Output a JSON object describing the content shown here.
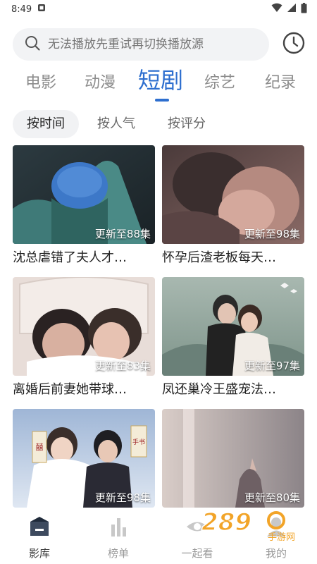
{
  "status_bar": {
    "time": "8:49"
  },
  "search": {
    "placeholder": "无法播放先重试再切换播放源"
  },
  "categories": [
    {
      "label": "电影"
    },
    {
      "label": "动漫"
    },
    {
      "label": "短剧"
    },
    {
      "label": "综艺"
    },
    {
      "label": "纪录"
    }
  ],
  "active_category": "短剧",
  "sort_options": [
    {
      "label": "按时间"
    },
    {
      "label": "按人气"
    },
    {
      "label": "按评分"
    }
  ],
  "active_sort": "按时间",
  "items": [
    {
      "title": "沈总虐错了夫人才…",
      "episodes": "更新至88集"
    },
    {
      "title": "怀孕后渣老板每天…",
      "episodes": "更新至98集"
    },
    {
      "title": "离婚后前妻她带球…",
      "episodes": "更新至83集"
    },
    {
      "title": "凤还巢冷王盛宠法…",
      "episodes": "更新至97集"
    },
    {
      "title": "",
      "episodes": "更新至98集",
      "poster_text": [
        "囍",
        "手书"
      ]
    },
    {
      "title": "",
      "episodes": "更新至80集"
    }
  ],
  "bottom_nav": [
    {
      "label": "影库",
      "icon": "library-icon"
    },
    {
      "label": "榜单",
      "icon": "rank-icon"
    },
    {
      "label": "一起看",
      "icon": "eye-icon"
    },
    {
      "label": "我的",
      "icon": "profile-icon"
    }
  ],
  "watermark": {
    "text": "289",
    "subtext": "手游网"
  },
  "colors": {
    "accent": "#2e6fcf",
    "muted": "#8c8c8c",
    "chip_bg": "#f1f2f4",
    "search_bg": "#f2f3f5"
  }
}
